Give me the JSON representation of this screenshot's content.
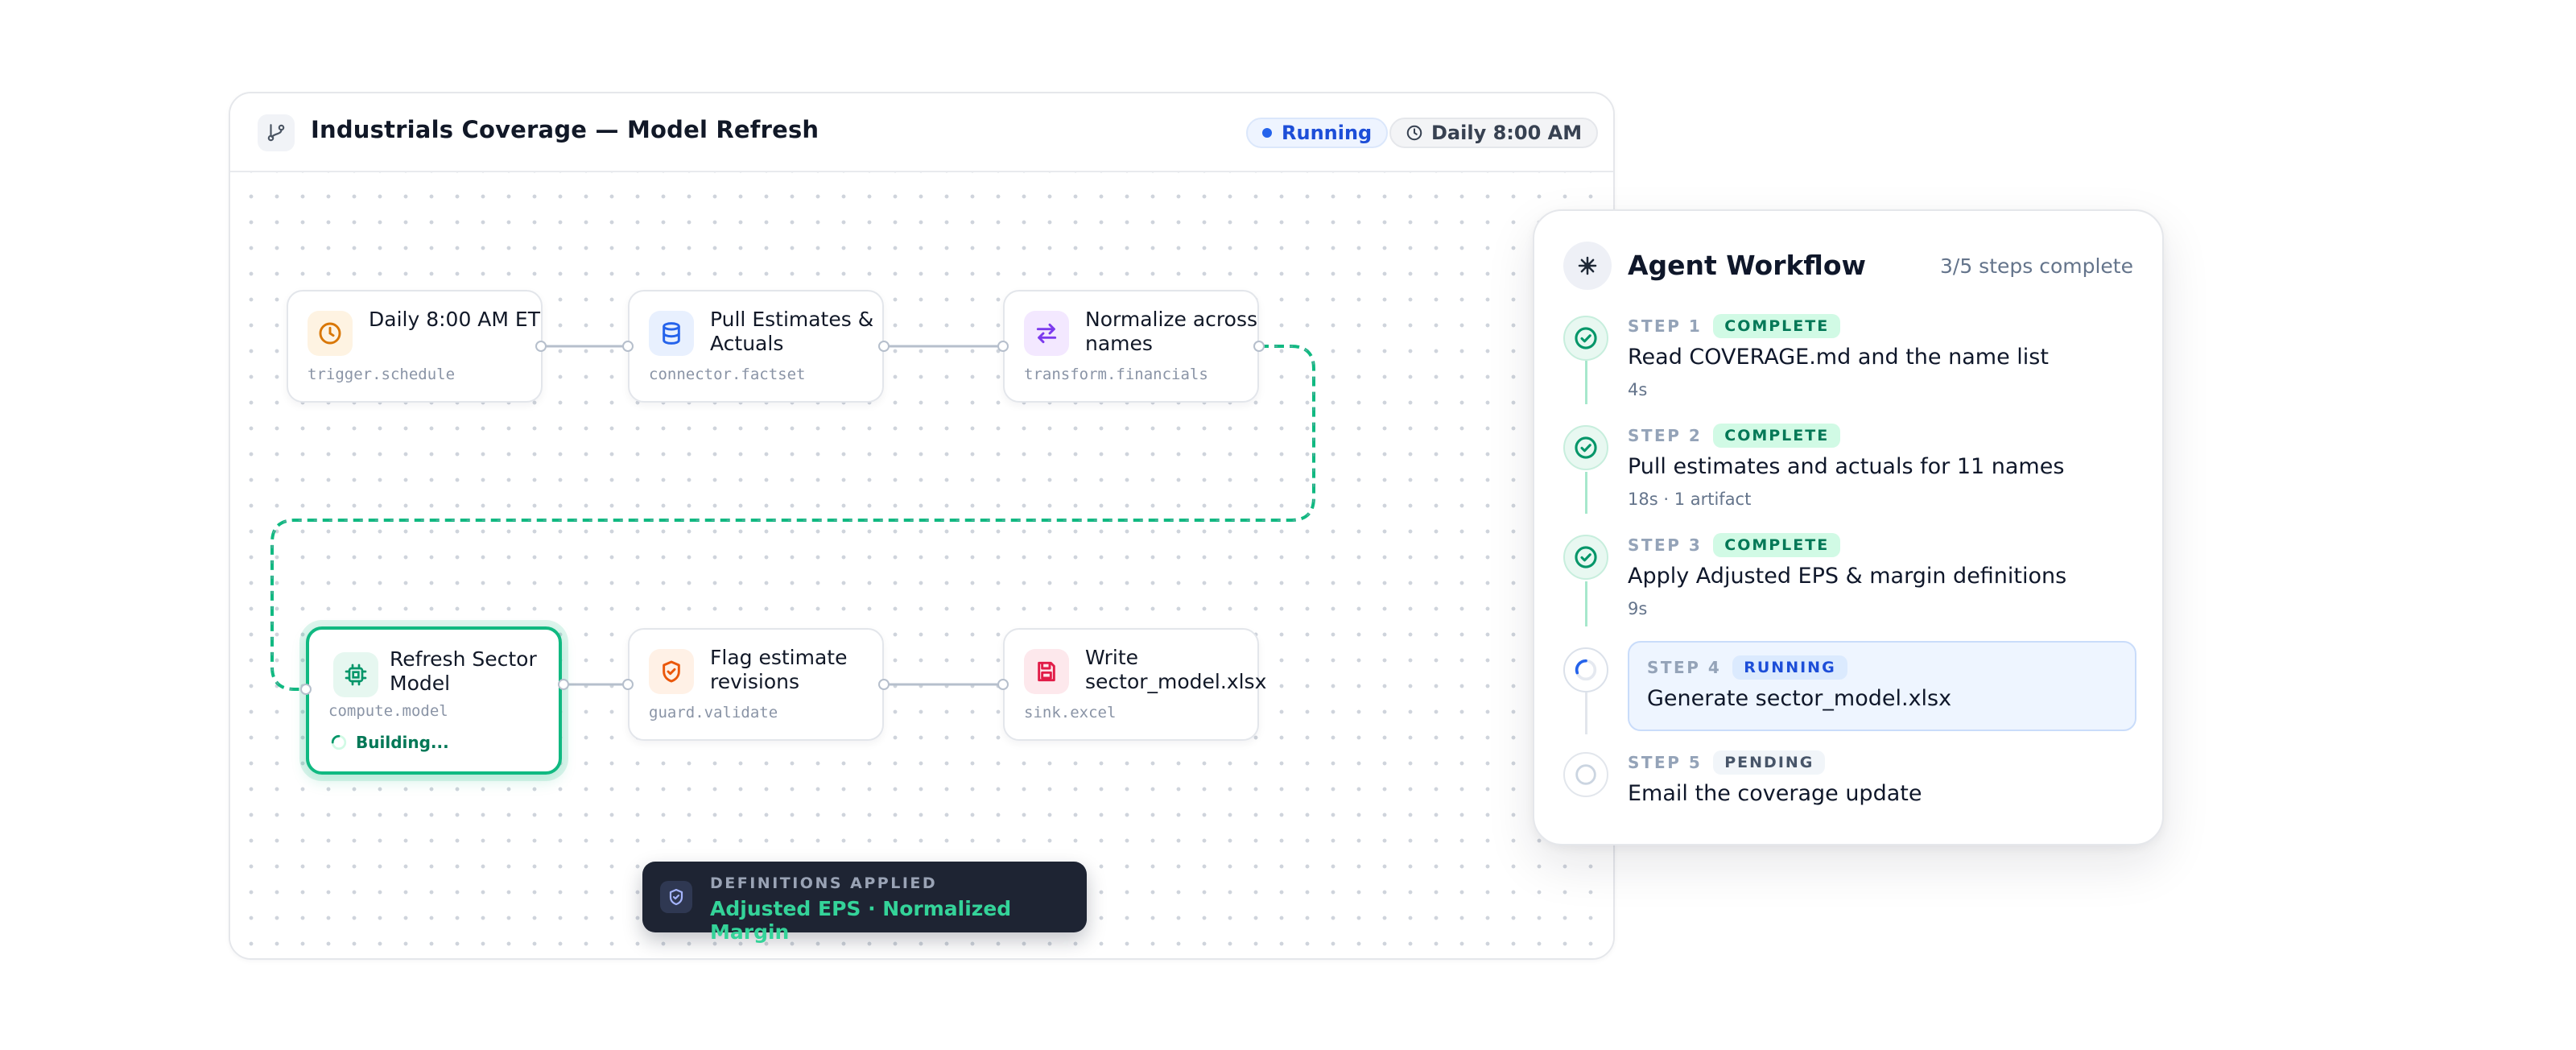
{
  "canvas": {
    "title": "Industrials Coverage — Model Refresh",
    "status_label": "Running",
    "schedule_label": "Daily 8:00 AM",
    "colors": {
      "running": "#2563eb",
      "active_edge": "#10b981",
      "edge": "#b6bfcc"
    }
  },
  "nodes": [
    {
      "title": "Daily 8:00 AM ET",
      "subtitle": "trigger.schedule",
      "icon": "clock-icon",
      "color": "#d97706"
    },
    {
      "title": "Pull Estimates & Actuals",
      "subtitle": "connector.factset",
      "icon": "database-icon",
      "color": "#2563eb"
    },
    {
      "title": "Normalize across names",
      "subtitle": "transform.financials",
      "icon": "arrows-swap-icon",
      "color": "#7c3aed"
    },
    {
      "title": "Refresh Sector Model",
      "subtitle": "compute.model",
      "icon": "cpu-chip-icon",
      "color": "#059669",
      "status": "Building..."
    },
    {
      "title": "Flag estimate revisions",
      "subtitle": "guard.validate",
      "icon": "shield-check-icon",
      "color": "#ea580c"
    },
    {
      "title": "Write sector_model.xlsx",
      "subtitle": "sink.excel",
      "icon": "save-disk-icon",
      "color": "#e11d48"
    }
  ],
  "definitions": {
    "label": "DEFINITIONS APPLIED",
    "value": "Adjusted EPS · Normalized Margin"
  },
  "workflow": {
    "title": "Agent Workflow",
    "progress": "3/5 steps complete",
    "steps": [
      {
        "label": "STEP 1",
        "status": "COMPLETE",
        "text": "Read COVERAGE.md and the name list",
        "meta": "4s"
      },
      {
        "label": "STEP 2",
        "status": "COMPLETE",
        "text": "Pull estimates and actuals for 11 names",
        "meta": "18s · 1 artifact"
      },
      {
        "label": "STEP 3",
        "status": "COMPLETE",
        "text": "Apply Adjusted EPS & margin definitions",
        "meta": "9s"
      },
      {
        "label": "STEP 4",
        "status": "RUNNING",
        "text": "Generate sector_model.xlsx",
        "meta": ""
      },
      {
        "label": "STEP 5",
        "status": "PENDING",
        "text": "Email the coverage update",
        "meta": ""
      }
    ]
  }
}
